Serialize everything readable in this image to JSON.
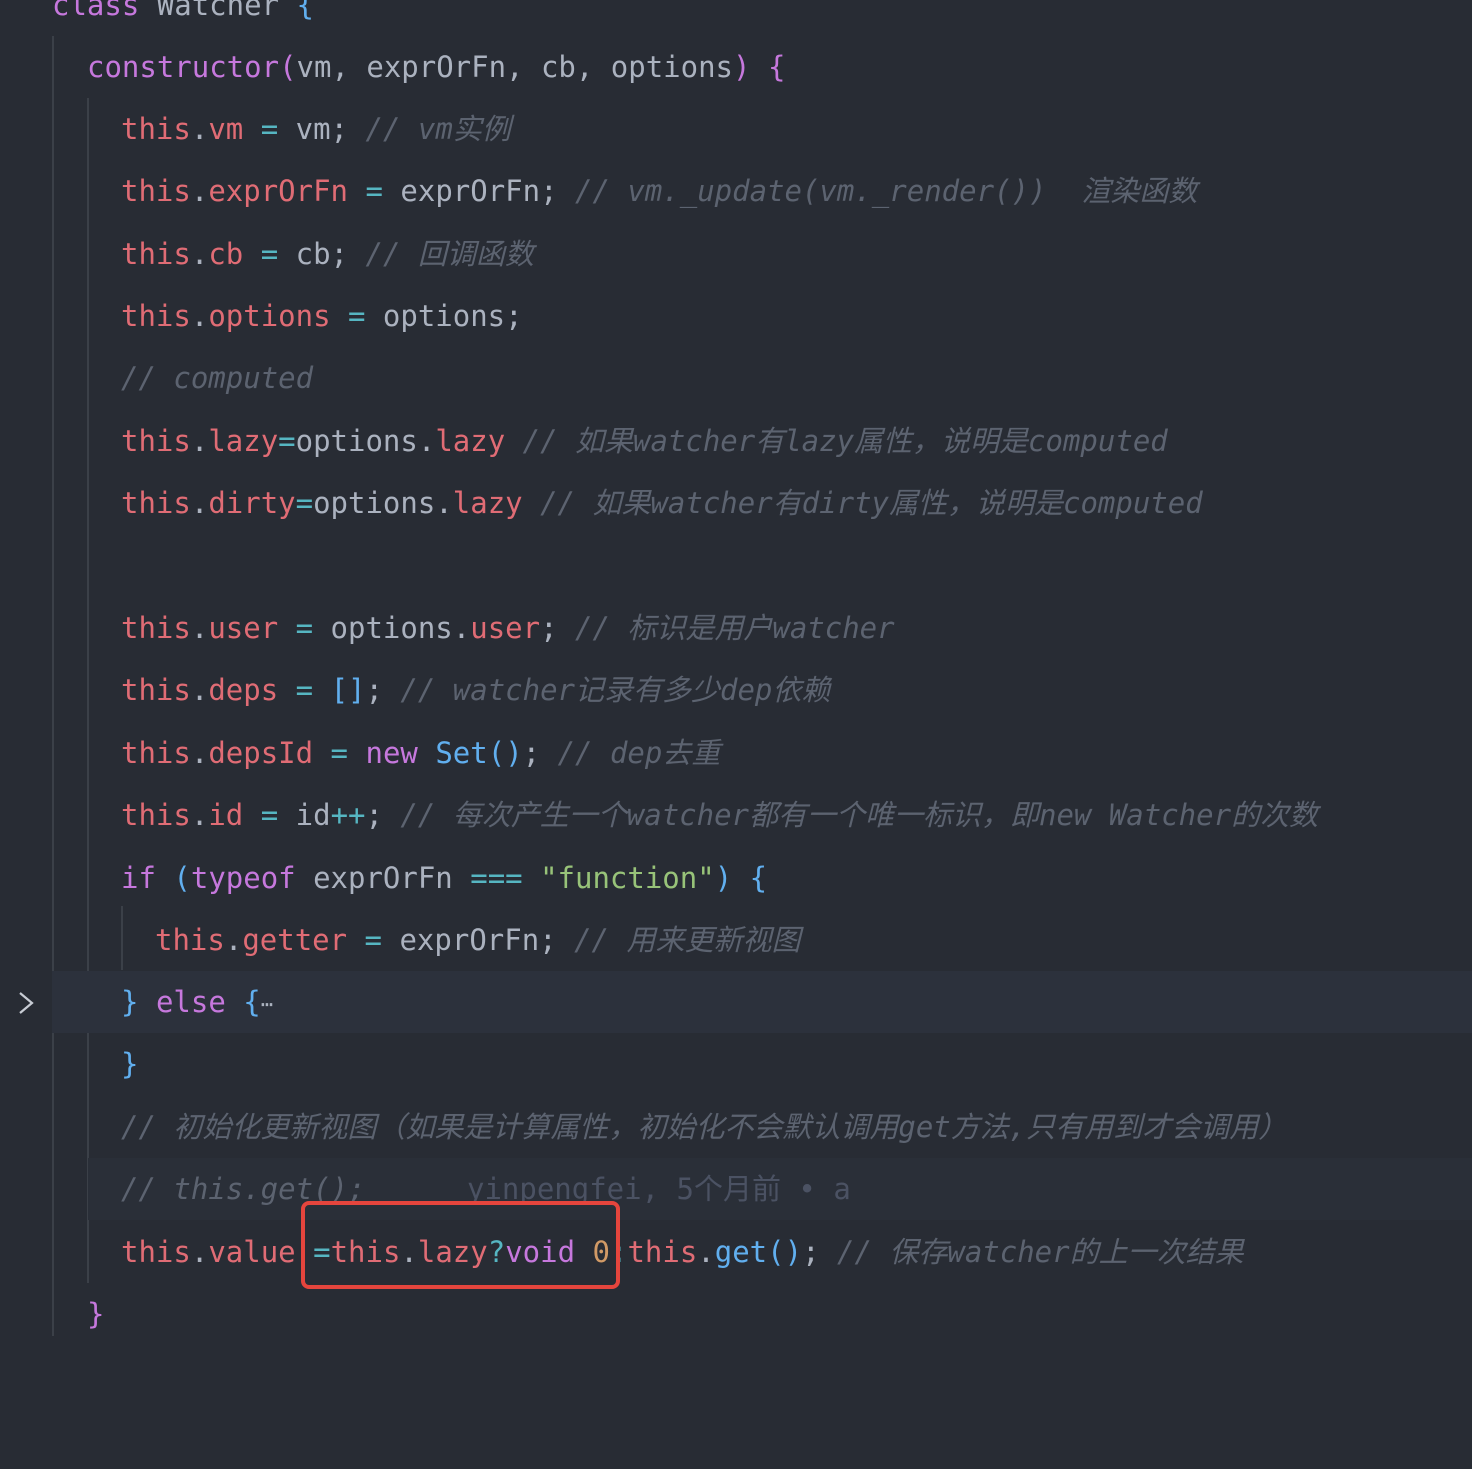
{
  "lines": {
    "l0": [
      "class",
      " Watcher ",
      "{"
    ],
    "l1": [
      "constructor",
      "(",
      "vm, exprOrFn, cb, options",
      ")",
      " ",
      "{"
    ],
    "l2": [
      "this",
      ".",
      "vm",
      " ",
      "=",
      " vm; ",
      "// vm实例"
    ],
    "l3": [
      "this",
      ".",
      "exprOrFn",
      " ",
      "=",
      " exprOrFn; ",
      "// vm._update(vm._render())  渲染函数"
    ],
    "l4": [
      "this",
      ".",
      "cb",
      " ",
      "=",
      " cb; ",
      "// 回调函数"
    ],
    "l5": [
      "this",
      ".",
      "options",
      " ",
      "=",
      " options;"
    ],
    "l6": [
      "// computed"
    ],
    "l7": [
      "this",
      ".",
      "lazy",
      "=",
      "options.",
      "lazy",
      " ",
      "// 如果watcher有lazy属性，说明是computed"
    ],
    "l8": [
      "this",
      ".",
      "dirty",
      "=",
      "options.",
      "lazy",
      " ",
      "// 如果watcher有dirty属性，说明是computed"
    ],
    "l10": [
      "this",
      ".",
      "user",
      " ",
      "=",
      " options.",
      "user",
      "; ",
      "// 标识是用户watcher"
    ],
    "l11": [
      "this",
      ".",
      "deps",
      " ",
      "=",
      " ",
      "[]",
      "; ",
      "// watcher记录有多少dep依赖"
    ],
    "l12": [
      "this",
      ".",
      "depsId",
      " ",
      "=",
      " ",
      "new",
      " ",
      "Set",
      "()",
      "; ",
      "// dep去重"
    ],
    "l13": [
      "this",
      ".",
      "id",
      " ",
      "=",
      " id",
      "++",
      "; ",
      "// 每次产生一个watcher都有一个唯一标识，即new Watcher的次数"
    ],
    "l14": [
      "if",
      " ",
      "(",
      "typeof",
      " exprOrFn ",
      "===",
      " ",
      "\"function\"",
      ")",
      " ",
      "{"
    ],
    "l15": [
      "this",
      ".",
      "getter",
      " ",
      "=",
      " exprOrFn; ",
      "// 用来更新视图"
    ],
    "l16": [
      "}",
      " ",
      "else",
      " ",
      "{",
      "⋯"
    ],
    "l17": [
      "}"
    ],
    "l18": [
      "// 初始化更新视图（如果是计算属性，初始化不会默认调用get方法,只有用到才会调用）"
    ],
    "l19": [
      "// this.get();",
      "yinpengfei, 5个月前 • a"
    ],
    "l20": [
      "this",
      ".",
      "value",
      " ",
      "=",
      "this",
      ".",
      "lazy",
      "?",
      "void",
      " ",
      "0",
      ":",
      "this",
      ".",
      "get",
      "()",
      "; ",
      "// 保存watcher的上一次结果"
    ],
    "l21": [
      "}"
    ]
  },
  "colors": {
    "background": "#282c34",
    "keyword": "#c678dd",
    "this": "#e06c75",
    "function": "#61afef",
    "string": "#98c379",
    "number": "#d19a66",
    "comment": "#5c6370",
    "highlight_box": "#e5453d"
  },
  "icons": {
    "fold": "chevron-right-icon"
  }
}
